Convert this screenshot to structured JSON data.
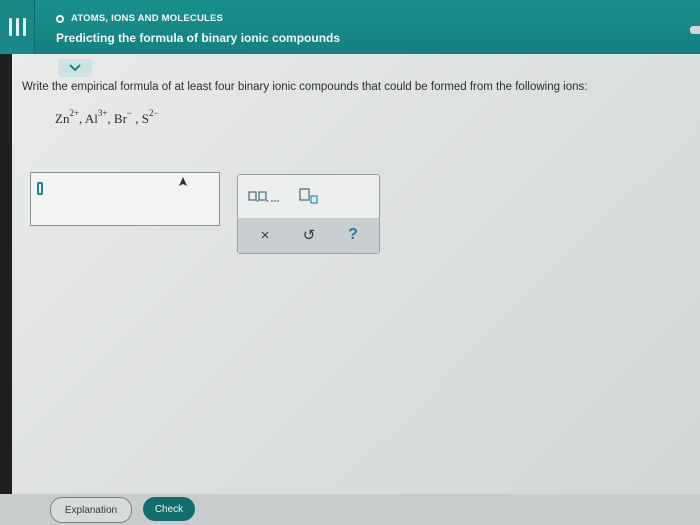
{
  "header": {
    "topic": "ATOMS, IONS AND MOLECULES",
    "title": "Predicting the formula of binary ionic compounds"
  },
  "question": {
    "prompt": "Write the empirical formula of at least four binary ionic compounds that could be formed from the following ions:",
    "ions": [
      {
        "symbol": "Zn",
        "charge": "2+",
        "sep": ", "
      },
      {
        "symbol": "Al",
        "charge": "3+",
        "sep": ", "
      },
      {
        "symbol": "Br",
        "charge": "−",
        "sep": " , "
      },
      {
        "symbol": "S",
        "charge": "2−",
        "sep": ""
      }
    ]
  },
  "palette": {
    "tools": [
      "list-template-icon",
      "subscript-template-icon",
      "clear-icon",
      "undo-icon",
      "help-icon"
    ],
    "list_label": "□,□,...",
    "clear": "×",
    "undo": "↺",
    "help": "?"
  },
  "footer": {
    "explanation_label": "Explanation",
    "check_label": "Check"
  },
  "colors": {
    "header": "#15807f",
    "check_button": "#136d6c"
  }
}
